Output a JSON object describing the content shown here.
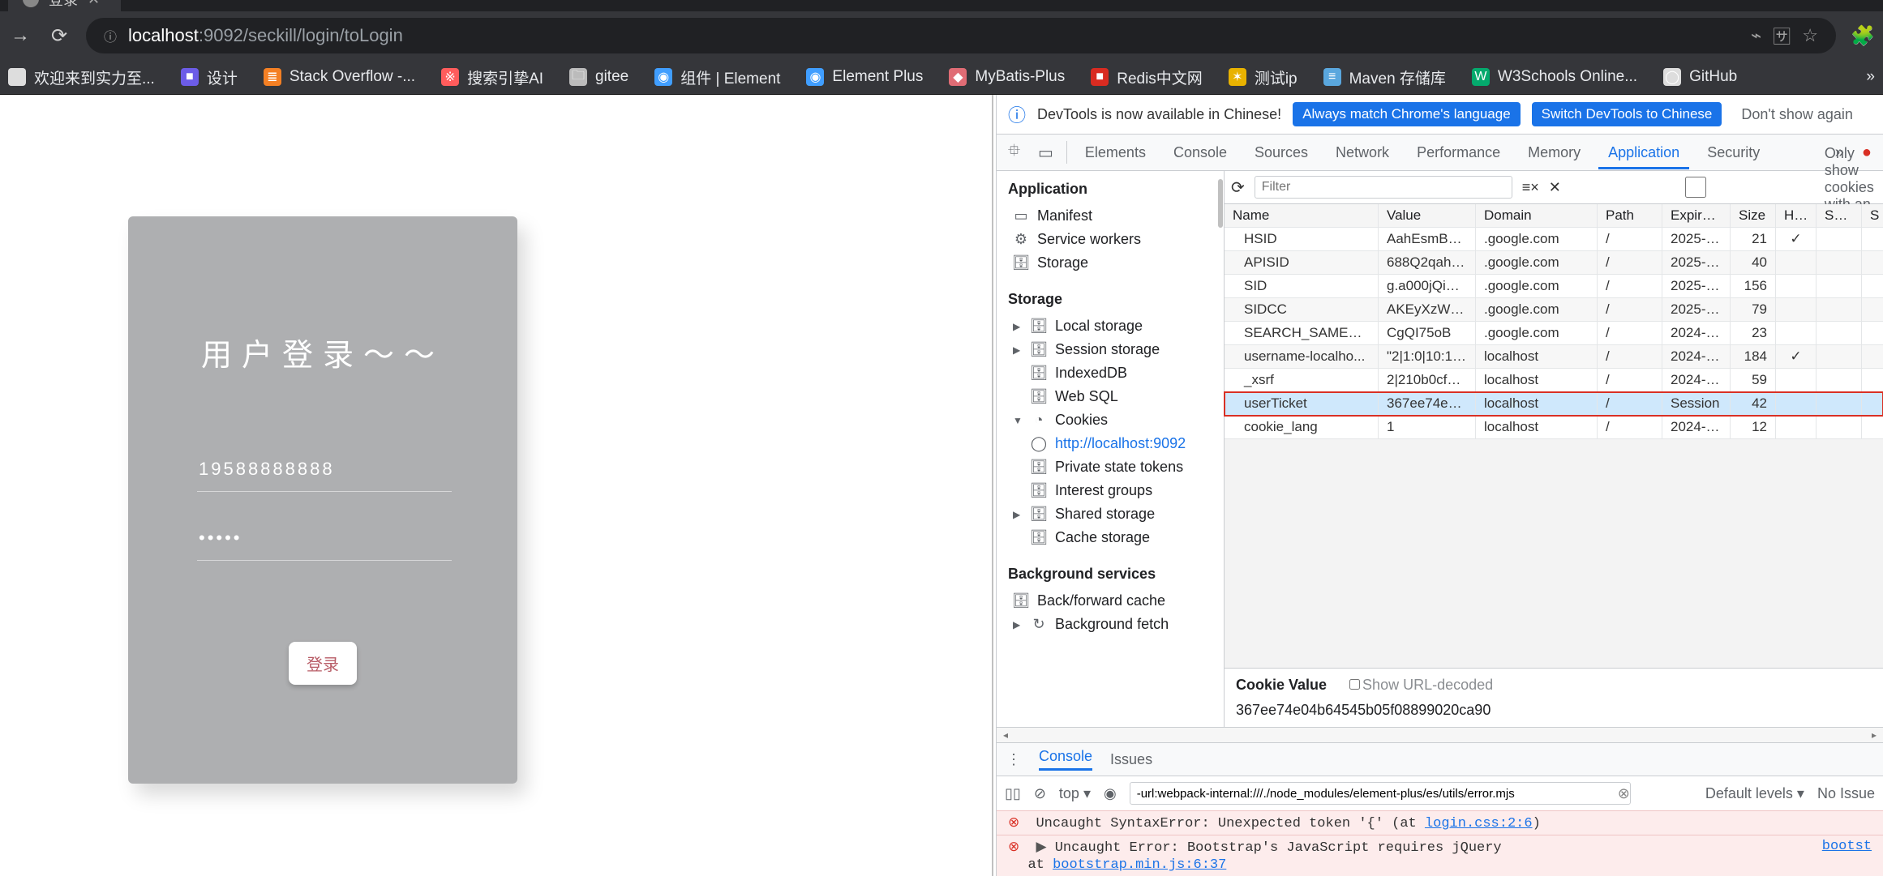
{
  "browser": {
    "tab_title": "登录",
    "url_host": "localhost",
    "url_port_path": ":9092/seckill/login/toLogin"
  },
  "bookmarks": [
    {
      "label": "欢迎来到实力至...",
      "icon": "",
      "color": "#ddd"
    },
    {
      "label": "设计",
      "icon": "■",
      "color": "#6c5ce7"
    },
    {
      "label": "Stack Overflow -...",
      "icon": "≣",
      "color": "#f48024"
    },
    {
      "label": "搜索引挚AI",
      "icon": "※",
      "color": "#ff5c5c"
    },
    {
      "label": "gitee",
      "icon": "🗀",
      "color": "#bbb"
    },
    {
      "label": "组件 | Element",
      "icon": "◉",
      "color": "#409eff"
    },
    {
      "label": "Element Plus",
      "icon": "◉",
      "color": "#409eff"
    },
    {
      "label": "MyBatis-Plus",
      "icon": "◆",
      "color": "#e06c75"
    },
    {
      "label": "Redis中文网",
      "icon": "■",
      "color": "#d92b21"
    },
    {
      "label": "测试ip",
      "icon": "✶",
      "color": "#e8b200"
    },
    {
      "label": "Maven 存储库",
      "icon": "≡",
      "color": "#5aa7de"
    },
    {
      "label": "W3Schools Online...",
      "icon": "W",
      "color": "#04aa6d"
    },
    {
      "label": "GitHub",
      "icon": "◯",
      "color": "#ddd"
    }
  ],
  "login": {
    "title": "用户登录～～",
    "username": "19588888888",
    "password": "•••••",
    "button": "登录"
  },
  "devtools": {
    "info": {
      "message": "DevTools is now available in Chinese!",
      "btn1": "Always match Chrome's language",
      "btn2": "Switch DevTools to Chinese",
      "dismiss": "Don't show again"
    },
    "tabs": [
      "Elements",
      "Console",
      "Sources",
      "Network",
      "Performance",
      "Memory",
      "Application",
      "Security"
    ],
    "active_tab": "Application",
    "sidebar": {
      "sections": {
        "Application": [
          "Manifest",
          "Service workers",
          "Storage"
        ],
        "Storage": [
          "Local storage",
          "Session storage",
          "IndexedDB",
          "Web SQL",
          "Cookies",
          "Private state tokens",
          "Interest groups",
          "Shared storage",
          "Cache storage"
        ],
        "Background services": [
          "Back/forward cache",
          "Background fetch"
        ]
      },
      "cookies_sub": "http://localhost:9092"
    },
    "filter_placeholder": "Filter",
    "only_issue": "Only show cookies with an issue",
    "cols": [
      "Name",
      "Value",
      "Domain",
      "Path",
      "Expires ...",
      "Size",
      "Htt...",
      "Sec...",
      " S"
    ],
    "rows": [
      {
        "name": "HSID",
        "value": "AahEsmBc5...",
        "domain": ".google.com",
        "path": "/",
        "exp": "2025-0...",
        "size": "21",
        "http": "✓",
        "sec": "",
        "s": ""
      },
      {
        "name": "APISID",
        "value": "688Q2qahD...",
        "domain": ".google.com",
        "path": "/",
        "exp": "2025-0...",
        "size": "40",
        "http": "",
        "sec": "",
        "s": ""
      },
      {
        "name": "SID",
        "value": "g.a000jQi8N...",
        "domain": ".google.com",
        "path": "/",
        "exp": "2025-0...",
        "size": "156",
        "http": "",
        "sec": "",
        "s": ""
      },
      {
        "name": "SIDCC",
        "value": "AKEyXzWQ_...",
        "domain": ".google.com",
        "path": "/",
        "exp": "2025-0...",
        "size": "79",
        "http": "",
        "sec": "",
        "s": ""
      },
      {
        "name": "SEARCH_SAMESITE",
        "value": "CgQI75oB",
        "domain": ".google.com",
        "path": "/",
        "exp": "2024-1...",
        "size": "23",
        "http": "",
        "sec": "",
        "s": ""
      },
      {
        "name": "username-localho...",
        "value": "\"2|1:0|10:17...",
        "domain": "localhost",
        "path": "/",
        "exp": "2024-0...",
        "size": "184",
        "http": "✓",
        "sec": "",
        "s": ""
      },
      {
        "name": "_xsrf",
        "value": "2|210b0cf1|...",
        "domain": "localhost",
        "path": "/",
        "exp": "2024-0...",
        "size": "59",
        "http": "",
        "sec": "",
        "s": ""
      },
      {
        "name": "userTicket",
        "value": "367ee74e04...",
        "domain": "localhost",
        "path": "/",
        "exp": "Session",
        "size": "42",
        "http": "",
        "sec": "",
        "s": "",
        "selected": true
      },
      {
        "name": "cookie_lang",
        "value": "1",
        "domain": "localhost",
        "path": "/",
        "exp": "2024-0...",
        "size": "12",
        "http": "",
        "sec": "",
        "s": ""
      }
    ],
    "cookie_value_label": "Cookie Value",
    "url_decoded": "Show URL-decoded",
    "cookie_value": "367ee74e04b64545b05f08899020ca90",
    "drawer_tabs": [
      "Console",
      "Issues"
    ],
    "console_filter": "-url:webpack-internal:///./node_modules/element-plus/es/utils/error.mjs",
    "levels": "Default levels",
    "top": "top",
    "no_issues": "No Issue",
    "err1_pre": "Uncaught SyntaxError: Unexpected token '{' (at ",
    "err1_link": "login.css:2:6",
    "err1_post": ")",
    "err2_head": "Uncaught Error: Bootstrap's JavaScript requires jQuery",
    "err2_at": "    at ",
    "err2_link": "bootstrap.min.js:6:37",
    "err2_right": "bootst"
  }
}
